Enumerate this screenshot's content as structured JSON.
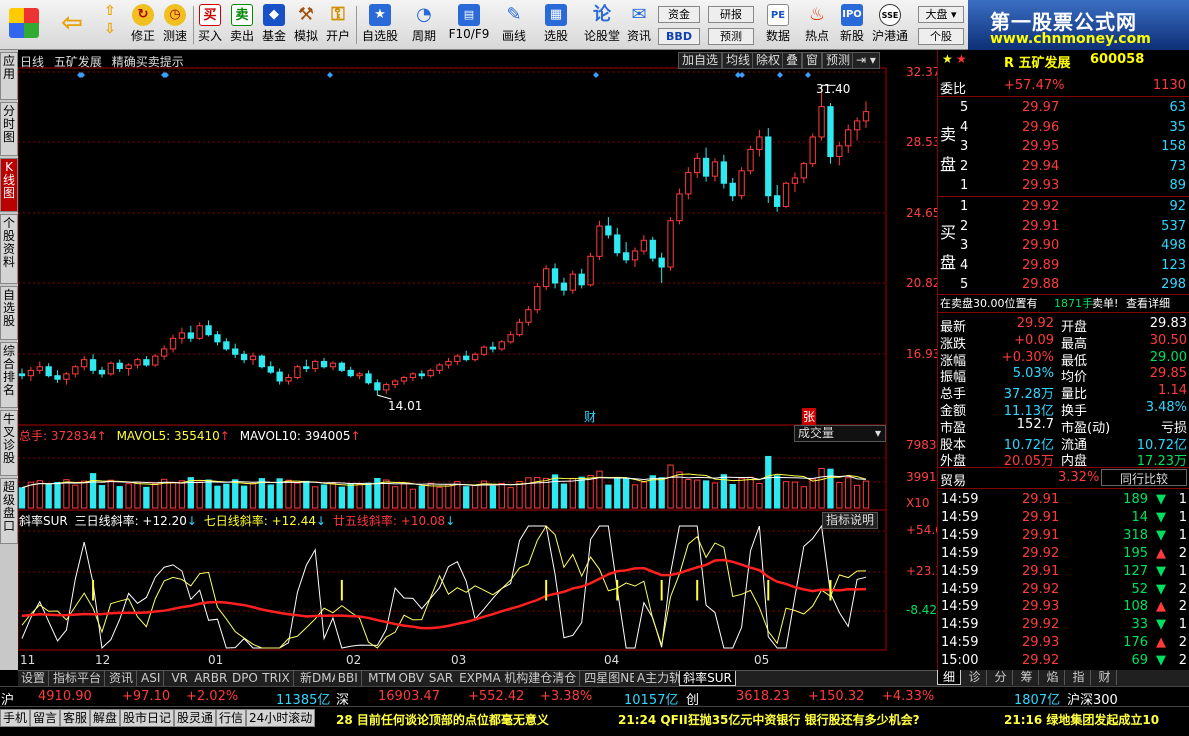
{
  "toolbar": {
    "buttons": [
      {
        "label": "",
        "icon": "windows-icon"
      },
      {
        "label": "",
        "icon": "back-arrow-icon"
      },
      {
        "label": "",
        "icon": "up-down-arrows-icon"
      },
      {
        "label": "修正",
        "icon": "refresh-icon"
      },
      {
        "label": "测速",
        "icon": "clock-icon"
      },
      {
        "label": "买入",
        "icon": "buy-icon"
      },
      {
        "label": "卖出",
        "icon": "sell-icon"
      },
      {
        "label": "基金",
        "icon": "fund-icon"
      },
      {
        "label": "模拟",
        "icon": "hammer-icon"
      },
      {
        "label": "开户",
        "icon": "lock-icon"
      },
      {
        "label": "自选股",
        "icon": "star-icon"
      },
      {
        "label": "周期",
        "icon": "period-icon"
      },
      {
        "label": "F10/F9",
        "icon": "f10-icon"
      },
      {
        "label": "画线",
        "icon": "pen-icon"
      },
      {
        "label": "选股",
        "icon": "screen-icon"
      },
      {
        "label": "论股堂",
        "icon": "forum-icon"
      },
      {
        "label": "资讯",
        "icon": "news-icon"
      },
      {
        "label": "数据",
        "icon": "pe-icon"
      },
      {
        "label": "热点",
        "icon": "fire-icon"
      },
      {
        "label": "新股",
        "icon": "ipo-icon"
      },
      {
        "label": "沪港通",
        "icon": "hk-icon"
      }
    ],
    "mini": [
      "资金",
      "研报",
      "BBD",
      "预测"
    ],
    "right": [
      "大盘",
      "个股"
    ]
  },
  "brand": {
    "title": "第一股票公式网",
    "url": "www.chnmoney.com"
  },
  "left_tabs": [
    "应用",
    "分时图",
    "K线图",
    "个股资料",
    "自选股",
    "综合排名",
    "牛叉诊股",
    "超级盘口"
  ],
  "chart": {
    "header": {
      "period": "日线",
      "stock": "五矿发展",
      "hint": "精确买卖提示"
    },
    "top_buttons": [
      "加自选",
      "均线",
      "除权",
      "叠",
      "窗",
      "预测"
    ],
    "price_ticks": [
      "32.37",
      "28.53",
      "24.65",
      "20.82",
      "16.93"
    ],
    "high_label": "31.40",
    "low_label": "14.01",
    "marks": {
      "cai": "财",
      "zhang": "张"
    },
    "volume": {
      "total": "总手: 372834",
      "ma5": "MAVOL5: 355410",
      "ma10": "MAVOL10: 394005",
      "dropdown": "成交量",
      "ticks": [
        "79832",
        "39916",
        "X10"
      ]
    },
    "sur": {
      "title": "斜率SUR",
      "l3": "三日线斜率: +12.20",
      "l7": "七日线斜率: +12.44",
      "l20": "廿五线斜率: +10.08",
      "btn": "指标说明",
      "ticks": [
        "+54.61",
        "+23.10",
        "-8.42"
      ]
    },
    "months": [
      "11",
      "12",
      "01",
      "02",
      "03",
      "04",
      "05"
    ]
  },
  "chart_data": {
    "type": "candlestick",
    "ylim": [
      12.5,
      32.37
    ],
    "ohlc": [
      [
        15.2,
        15.5,
        14.9,
        15.1
      ],
      [
        15.1,
        15.6,
        14.8,
        15.4
      ],
      [
        15.4,
        15.9,
        15.2,
        15.6
      ],
      [
        15.6,
        15.8,
        15.0,
        15.1
      ],
      [
        15.1,
        15.4,
        14.7,
        14.9
      ],
      [
        14.9,
        15.3,
        14.6,
        15.2
      ],
      [
        15.2,
        15.7,
        15.0,
        15.6
      ],
      [
        15.6,
        16.2,
        15.4,
        16.0
      ],
      [
        16.0,
        16.3,
        15.2,
        15.4
      ],
      [
        15.4,
        15.6,
        15.0,
        15.2
      ],
      [
        15.2,
        15.9,
        15.1,
        15.8
      ],
      [
        15.8,
        16.0,
        15.3,
        15.5
      ],
      [
        15.5,
        15.8,
        15.1,
        15.7
      ],
      [
        15.7,
        16.1,
        15.5,
        16.0
      ],
      [
        16.0,
        16.2,
        15.6,
        15.7
      ],
      [
        15.7,
        16.3,
        15.6,
        16.2
      ],
      [
        16.2,
        16.8,
        16.0,
        16.6
      ],
      [
        16.6,
        17.4,
        16.4,
        17.2
      ],
      [
        17.2,
        17.8,
        16.9,
        17.5
      ],
      [
        17.5,
        17.9,
        17.0,
        17.2
      ],
      [
        17.2,
        18.1,
        17.1,
        17.9
      ],
      [
        17.9,
        18.2,
        17.3,
        17.4
      ],
      [
        17.4,
        17.6,
        16.8,
        17.0
      ],
      [
        17.0,
        17.2,
        16.5,
        16.6
      ],
      [
        16.6,
        16.9,
        16.1,
        16.3
      ],
      [
        16.3,
        16.5,
        15.8,
        16.0
      ],
      [
        16.0,
        16.4,
        15.7,
        16.2
      ],
      [
        16.2,
        16.3,
        15.5,
        15.6
      ],
      [
        15.6,
        15.9,
        15.2,
        15.3
      ],
      [
        15.3,
        15.5,
        14.6,
        14.8
      ],
      [
        14.8,
        15.2,
        14.6,
        15.0
      ],
      [
        15.0,
        15.7,
        14.9,
        15.6
      ],
      [
        15.6,
        16.0,
        15.3,
        15.5
      ],
      [
        15.5,
        16.0,
        15.3,
        15.9
      ],
      [
        15.9,
        16.1,
        15.5,
        15.6
      ],
      [
        15.6,
        15.9,
        15.4,
        15.8
      ],
      [
        15.8,
        15.9,
        15.3,
        15.4
      ],
      [
        15.4,
        15.6,
        15.0,
        15.1
      ],
      [
        15.1,
        15.3,
        14.9,
        15.2
      ],
      [
        15.2,
        15.4,
        14.6,
        14.7
      ],
      [
        14.7,
        14.9,
        14.01,
        14.3
      ],
      [
        14.3,
        14.7,
        14.1,
        14.6
      ],
      [
        14.6,
        14.9,
        14.4,
        14.8
      ],
      [
        14.8,
        15.1,
        14.6,
        15.0
      ],
      [
        15.0,
        15.3,
        14.8,
        15.2
      ],
      [
        15.2,
        15.4,
        14.9,
        15.1
      ],
      [
        15.1,
        15.5,
        15.0,
        15.4
      ],
      [
        15.4,
        15.8,
        15.2,
        15.7
      ],
      [
        15.7,
        16.1,
        15.5,
        15.9
      ],
      [
        15.9,
        16.3,
        15.7,
        16.2
      ],
      [
        16.2,
        16.5,
        15.9,
        16.0
      ],
      [
        16.0,
        16.4,
        15.9,
        16.3
      ],
      [
        16.3,
        16.8,
        16.2,
        16.7
      ],
      [
        16.7,
        17.0,
        16.4,
        16.6
      ],
      [
        16.6,
        17.1,
        16.5,
        17.0
      ],
      [
        17.0,
        17.6,
        16.9,
        17.4
      ],
      [
        17.4,
        18.3,
        17.3,
        18.1
      ],
      [
        18.1,
        19.0,
        17.9,
        18.8
      ],
      [
        18.8,
        20.3,
        18.6,
        20.1
      ],
      [
        20.1,
        21.3,
        19.9,
        21.1
      ],
      [
        21.1,
        21.4,
        20.0,
        20.3
      ],
      [
        20.3,
        20.6,
        19.6,
        19.9
      ],
      [
        19.9,
        21.0,
        19.7,
        20.8
      ],
      [
        20.8,
        21.1,
        20.0,
        20.2
      ],
      [
        20.2,
        22.0,
        20.1,
        21.8
      ],
      [
        21.8,
        23.8,
        21.6,
        23.5
      ],
      [
        23.5,
        24.0,
        22.8,
        23.0
      ],
      [
        23.0,
        23.4,
        21.8,
        22.0
      ],
      [
        22.0,
        22.6,
        21.4,
        21.6
      ],
      [
        21.6,
        22.3,
        21.2,
        22.1
      ],
      [
        22.1,
        23.0,
        21.9,
        22.7
      ],
      [
        22.7,
        22.9,
        21.5,
        21.7
      ],
      [
        21.7,
        22.0,
        20.3,
        21.2
      ],
      [
        21.2,
        24.0,
        21.0,
        23.8
      ],
      [
        23.8,
        25.6,
        23.6,
        25.3
      ],
      [
        25.3,
        26.8,
        25.0,
        26.5
      ],
      [
        26.5,
        27.6,
        26.2,
        27.3
      ],
      [
        27.3,
        27.9,
        26.0,
        26.3
      ],
      [
        26.3,
        27.3,
        26.0,
        27.1
      ],
      [
        27.1,
        27.5,
        25.6,
        25.9
      ],
      [
        25.9,
        26.2,
        24.9,
        25.2
      ],
      [
        25.2,
        26.8,
        25.0,
        26.6
      ],
      [
        26.6,
        28.0,
        26.4,
        27.8
      ],
      [
        27.8,
        28.9,
        27.4,
        28.5
      ],
      [
        28.5,
        29.0,
        24.8,
        25.2
      ],
      [
        25.2,
        25.8,
        24.3,
        24.6
      ],
      [
        24.6,
        26.0,
        24.5,
        25.9
      ],
      [
        25.9,
        26.5,
        25.4,
        26.2
      ],
      [
        26.2,
        27.1,
        25.9,
        27.0
      ],
      [
        27.0,
        28.7,
        26.8,
        28.5
      ],
      [
        28.5,
        31.4,
        28.3,
        30.2
      ],
      [
        30.2,
        30.4,
        27.0,
        27.4
      ],
      [
        27.4,
        28.2,
        26.9,
        28.0
      ],
      [
        28.0,
        29.2,
        27.6,
        28.9
      ],
      [
        28.9,
        29.6,
        28.3,
        29.4
      ],
      [
        29.4,
        30.5,
        29.0,
        29.92
      ]
    ],
    "volume_ylim": [
      0,
      79832
    ],
    "sur_ylim": [
      -25,
      70
    ]
  },
  "right_panel": {
    "stock_name": "R 五矿发展",
    "stock_code": "600058",
    "weibi_label": "委比",
    "weibi": "+57.47%",
    "weicha": "1130",
    "sell_label": "卖盘",
    "buy_label": "买盘",
    "sell": [
      [
        "5",
        "29.97",
        "63"
      ],
      [
        "4",
        "29.96",
        "35"
      ],
      [
        "3",
        "29.95",
        "158"
      ],
      [
        "2",
        "29.94",
        "73"
      ],
      [
        "1",
        "29.93",
        "89"
      ]
    ],
    "buy": [
      [
        "1",
        "29.92",
        "92"
      ],
      [
        "2",
        "29.91",
        "537"
      ],
      [
        "3",
        "29.90",
        "498"
      ],
      [
        "4",
        "29.89",
        "123"
      ],
      [
        "5",
        "29.88",
        "298"
      ]
    ],
    "notice": {
      "a": "在卖盘30.00位置有",
      "b": "1871手",
      "c": "卖单!",
      "d": "查看详细"
    },
    "stats": [
      [
        "最新",
        "29.92",
        "开盘",
        "29.83"
      ],
      [
        "涨跌",
        "+0.09",
        "最高",
        "30.50"
      ],
      [
        "涨幅",
        "+0.30%",
        "最低",
        "29.00"
      ],
      [
        "振幅",
        "5.03%",
        "均价",
        "29.85"
      ],
      [
        "总手",
        "37.28万",
        "量比",
        "1.14"
      ],
      [
        "金额",
        "11.13亿",
        "换手",
        "3.48%"
      ],
      [
        "市盈",
        "152.7",
        "市盈(动)",
        "亏损"
      ],
      [
        "股本",
        "10.72亿",
        "流通",
        "10.72亿"
      ],
      [
        "外盘",
        "20.05万",
        "内盘",
        "17.23万"
      ]
    ],
    "industry": {
      "name": "贸易",
      "pct": "3.32%",
      "btn": "同行比较"
    },
    "ticks": [
      [
        "14:59",
        "29.91",
        "189",
        "1"
      ],
      [
        "14:59",
        "29.91",
        "14",
        "1"
      ],
      [
        "14:59",
        "29.91",
        "318",
        "1"
      ],
      [
        "14:59",
        "29.92",
        "195",
        "2"
      ],
      [
        "14:59",
        "29.91",
        "127",
        "1"
      ],
      [
        "14:59",
        "29.92",
        "52",
        "2"
      ],
      [
        "14:59",
        "29.93",
        "108",
        "2"
      ],
      [
        "14:59",
        "29.92",
        "33",
        "1"
      ],
      [
        "14:59",
        "29.93",
        "176",
        "2"
      ],
      [
        "15:00",
        "29.92",
        "69",
        "2"
      ]
    ],
    "tabs": [
      "细",
      "诊",
      "分",
      "筹",
      "焰",
      "指",
      "财"
    ]
  },
  "bottom_tabs": [
    "设置",
    "指标平台",
    "资讯",
    "ASI",
    "VR",
    "ARBR",
    "DPO",
    "TRIX",
    "新DMA",
    "BBI",
    "MTM",
    "OBV",
    "SAR",
    "EXPMA",
    "机构建仓清仓",
    "四星图NEW",
    "A主力轨迹",
    "斜率SUR"
  ],
  "index_bar": {
    "sh": "沪",
    "sh_v": "4910.90",
    "sh_c": "+97.10",
    "sh_p": "+2.02%",
    "sh_a": "11385亿",
    "sz": "深",
    "sz_v": "16903.47",
    "sz_c": "+552.42",
    "sz_p": "+3.38%",
    "sz_a": "10157亿",
    "cy": "创",
    "cy_v": "3618.23",
    "cy_c": "+150.32",
    "cy_p": "+4.33%",
    "cy_a": "1807亿",
    "hs": "沪深300"
  },
  "status": {
    "buttons": [
      "手机",
      "留言",
      "客服",
      "解盘",
      "股市日记",
      "股灵通",
      "行信",
      "24小时滚动"
    ],
    "news1": "28 目前任何谈论顶部的点位都毫无意义",
    "news2": "21:24 QFII狂抛35亿元中资银行 银行股还有多少机会?",
    "news3": "21:16 绿地集团发起成立10"
  }
}
